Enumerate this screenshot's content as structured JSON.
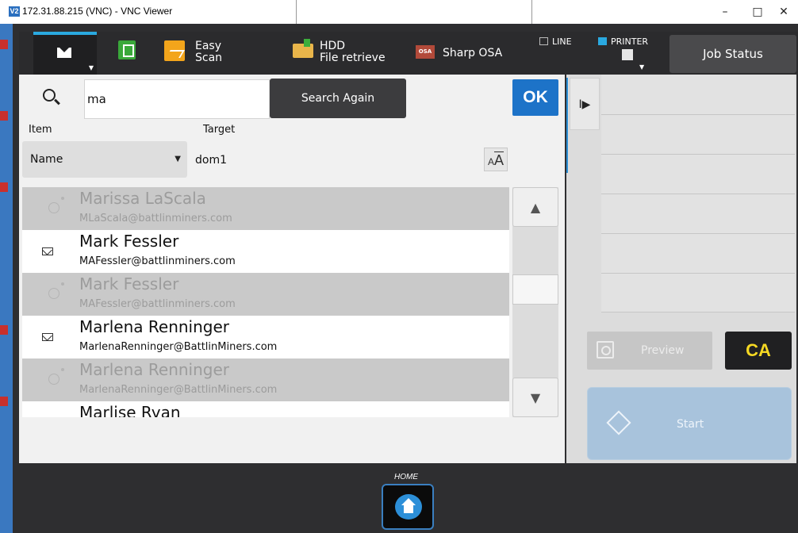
{
  "window": {
    "title": "172.31.88.215 (VNC) - VNC Viewer",
    "app_icon": "V2",
    "minimize": "–",
    "maximize": "□",
    "close": "✕"
  },
  "toolbar": {
    "easy_scan_line1": "Easy",
    "easy_scan_line2": "Scan",
    "hdd_line1": "HDD",
    "hdd_line2": "File retrieve",
    "sharp_osa": "Sharp OSA",
    "osa_icon_text": "OSA",
    "line_label": "LINE",
    "printer_label": "PRINTER",
    "job_status": "Job Status",
    "accent_color": "#2aa9e0"
  },
  "search": {
    "value": "ma",
    "search_again": "Search Again",
    "ok": "OK",
    "item_label": "Item",
    "target_label": "Target",
    "item_value": "Name",
    "target_value": "dom1",
    "font_size_small": "A",
    "font_size_large": "A"
  },
  "results": [
    {
      "name": "Marissa  LaScala",
      "email": "MLaScala@battlinminers.com",
      "state": "disabled",
      "icon": "globe-icon"
    },
    {
      "name": "Mark Fessler",
      "email": "MAFessler@battlinminers.com",
      "state": "enabled",
      "icon": "envelope-icon"
    },
    {
      "name": "Mark Fessler",
      "email": "MAFessler@battlinminers.com",
      "state": "disabled",
      "icon": "globe-icon"
    },
    {
      "name": "Marlena Renninger",
      "email": "MarlenaRenninger@BattlinMiners.com",
      "state": "enabled",
      "icon": "envelope-icon"
    },
    {
      "name": "Marlena Renninger",
      "email": "MarlenaRenninger@BattlinMiners.com",
      "state": "disabled",
      "icon": "globe-icon"
    },
    {
      "name": "Marlise Ryan",
      "email": "",
      "state": "enabled",
      "icon": "none"
    }
  ],
  "scroll": {
    "up": "▲",
    "down": "▼"
  },
  "right_panel": {
    "preview": "Preview",
    "ca": "CA",
    "start": "Start",
    "side_tab": "I▶"
  },
  "home": {
    "label": "HOME"
  }
}
